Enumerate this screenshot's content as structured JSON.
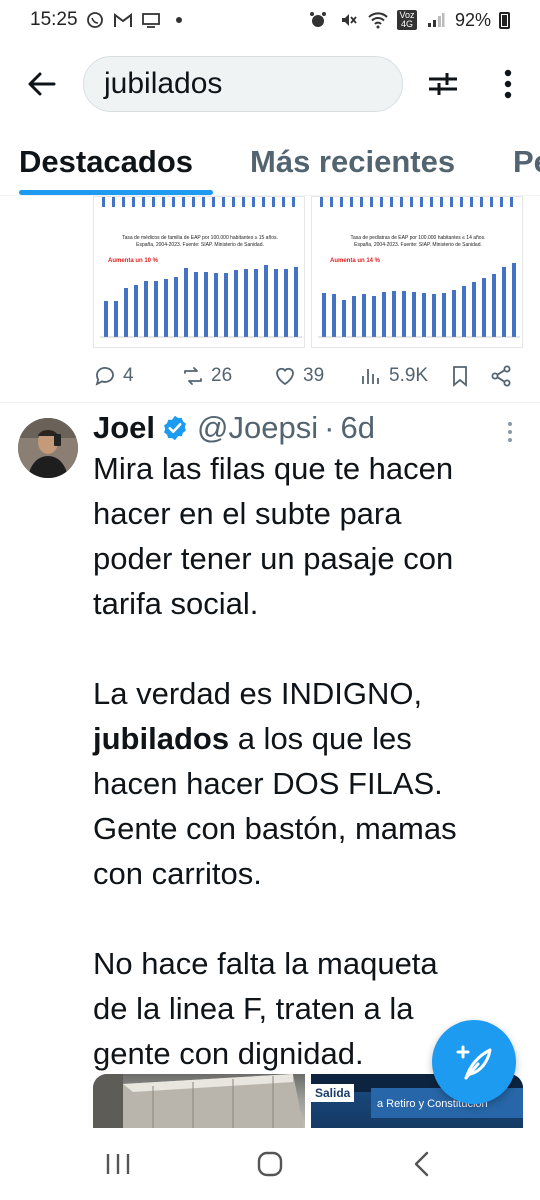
{
  "status_bar": {
    "time": "15:25",
    "battery": "92%",
    "network_label": "Voz 4G",
    "left_icons": [
      "whatsapp-icon",
      "gmail-icon",
      "cast-icon",
      "dot-icon"
    ],
    "right_icons": [
      "alarm-icon",
      "mute-icon",
      "wifi-icon",
      "signal-icon",
      "battery-icon"
    ]
  },
  "search": {
    "query": "jubilados"
  },
  "tabs": [
    {
      "label": "Destacados",
      "active": true
    },
    {
      "label": "Más recientes",
      "active": false
    },
    {
      "label": "Pe",
      "active": false
    }
  ],
  "previous_tweet": {
    "media": [
      {
        "title_line1": "Tasa de médicos de familia de EAP por 100.000 habitantes ≥ 15 años.",
        "title_line2": "España, 2004-2023. Fuente: SIAP. Ministerio de Sanidad.",
        "annotation": "Aumenta un 10 %"
      },
      {
        "title_line1": "Tasa de pediatras de EAP por 100.000 habitantes ≤ 14 años.",
        "title_line2": "España, 2004-2023. Fuente: SIAP. Ministerio de Sanidad.",
        "annotation": "Aumenta un 14 %"
      }
    ],
    "actions": {
      "replies": "4",
      "reposts": "26",
      "likes": "39",
      "views": "5.9K"
    }
  },
  "tweet": {
    "name": "Joel",
    "handle": "@Joepsi",
    "time_sep": "·",
    "time": "6d",
    "lines": [
      "Mira las filas que te hacen",
      "hacer en el subte para",
      "poder tener un pasaje con",
      "tarifa social.",
      "",
      "La verdad es INDIGNO,",
      "a los que les",
      "hacen hacer DOS FILAS.",
      "Gente con bastón, mamas",
      "con carritos.",
      "",
      "No hace falta la maqueta",
      "de la linea F, traten a la",
      "gente con dignidad."
    ],
    "highlight_word": "jubilados",
    "media_signs": {
      "salida": "Salida",
      "direction": "a Retiro y Constitución"
    }
  },
  "colors": {
    "accent": "#1d9bf0",
    "text": "#0f1419",
    "muted": "#536471",
    "chart_bar": "#4472c4",
    "chart_annotation": "#e02020"
  }
}
